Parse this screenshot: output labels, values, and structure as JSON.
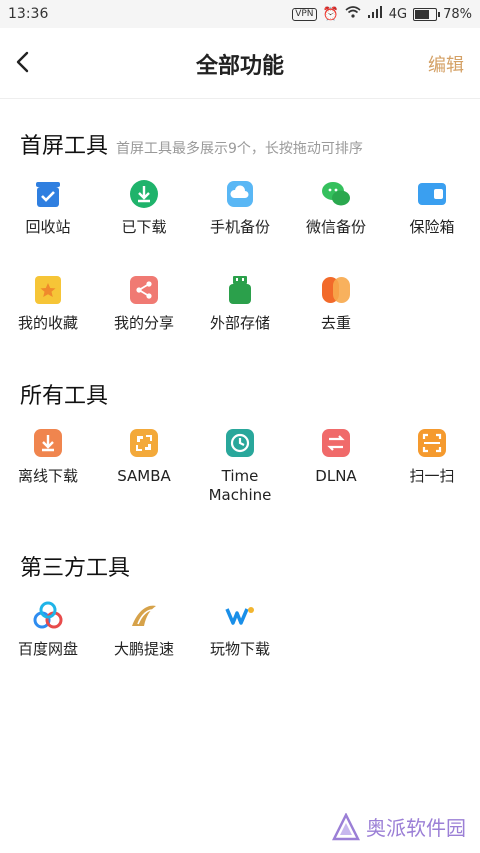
{
  "status": {
    "time": "13:36",
    "vpn": "VPN",
    "network": "4G",
    "battery_text": "78%",
    "battery_level": 0.78
  },
  "header": {
    "title": "全部功能",
    "edit": "编辑"
  },
  "sections": {
    "home": {
      "title": "首屏工具",
      "subtitle": "首屏工具最多展示9个，长按拖动可排序",
      "items": [
        {
          "label": "回收站",
          "icon": "recycle-bin-icon",
          "color": "#2f7fe0"
        },
        {
          "label": "已下载",
          "icon": "downloaded-icon",
          "color": "#1fb36b"
        },
        {
          "label": "手机备份",
          "icon": "phone-backup-icon",
          "color": "#59b7f5"
        },
        {
          "label": "微信备份",
          "icon": "wechat-backup-icon",
          "color": "#35c05d"
        },
        {
          "label": "保险箱",
          "icon": "safe-box-icon",
          "color": "#3a9ff0"
        },
        {
          "label": "我的收藏",
          "icon": "favorites-icon",
          "color": "#f6c537"
        },
        {
          "label": "我的分享",
          "icon": "share-icon",
          "color": "#f07a73"
        },
        {
          "label": "外部存储",
          "icon": "usb-storage-icon",
          "color": "#2ba04b"
        },
        {
          "label": "去重",
          "icon": "dedupe-icon",
          "color": "#f08a2c"
        }
      ]
    },
    "all": {
      "title": "所有工具",
      "items": [
        {
          "label": "离线下载",
          "icon": "offline-download-icon",
          "color": "#f0854e"
        },
        {
          "label": "SAMBA",
          "icon": "samba-icon",
          "color": "#f3a93a"
        },
        {
          "label": "Time Machine",
          "icon": "time-machine-icon",
          "color": "#29a79b"
        },
        {
          "label": "DLNA",
          "icon": "dlna-icon",
          "color": "#f06a6a"
        },
        {
          "label": "扫一扫",
          "icon": "scan-icon",
          "color": "#f59a2e"
        }
      ]
    },
    "third": {
      "title": "第三方工具",
      "items": [
        {
          "label": "百度网盘",
          "icon": "baidu-netdisk-icon",
          "color": "#2d8cf0"
        },
        {
          "label": "大鹏提速",
          "icon": "dapeng-speed-icon",
          "color": "#d6a24a"
        },
        {
          "label": "玩物下载",
          "icon": "wanwu-download-icon",
          "color": "#1a8fe8"
        }
      ]
    }
  },
  "watermark": {
    "text": "奥派软件园"
  }
}
